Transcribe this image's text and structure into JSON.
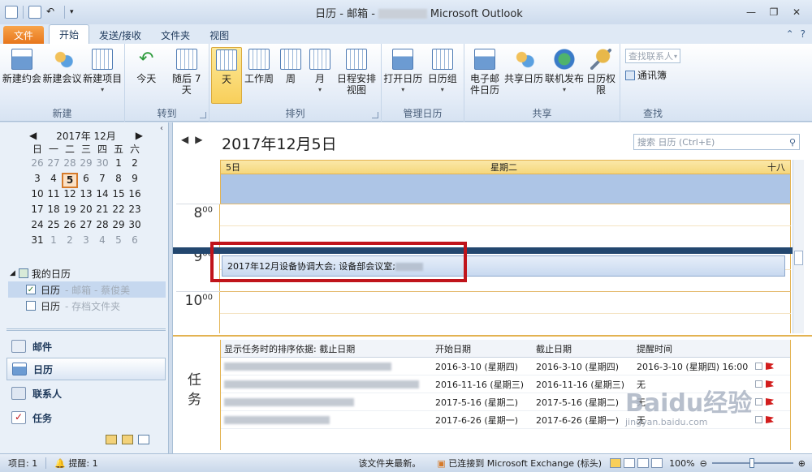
{
  "window": {
    "title_prefix": "日历 - 邮箱 -",
    "title_suffix": "Microsoft Outlook"
  },
  "tabs": {
    "file": "文件",
    "items": [
      "开始",
      "发送/接收",
      "文件夹",
      "视图"
    ]
  },
  "ribbon": {
    "groups": {
      "new": {
        "label": "新建",
        "buttons": [
          "新建约会",
          "新建会议",
          "新建项目"
        ]
      },
      "goto": {
        "label": "转到",
        "buttons": [
          "今天",
          "随后 7 天"
        ]
      },
      "arrange": {
        "label": "排列",
        "buttons": [
          "天",
          "工作周",
          "周",
          "月",
          "日程安排视图"
        ]
      },
      "manage": {
        "label": "管理日历",
        "buttons": [
          "打开日历",
          "日历组"
        ]
      },
      "share": {
        "label": "共享",
        "buttons": [
          "电子邮件日历",
          "共享日历",
          "联机发布",
          "日历权限"
        ]
      },
      "find": {
        "label": "查找",
        "find_contact": "查找联系人",
        "address_book": "通讯簿"
      }
    }
  },
  "minical": {
    "month": "2017年 12月",
    "dow": [
      "日",
      "一",
      "二",
      "三",
      "四",
      "五",
      "六"
    ],
    "rows": [
      [
        "26",
        "27",
        "28",
        "29",
        "30",
        "1",
        "2"
      ],
      [
        "3",
        "4",
        "5",
        "6",
        "7",
        "8",
        "9"
      ],
      [
        "10",
        "11",
        "12",
        "13",
        "14",
        "15",
        "16"
      ],
      [
        "17",
        "18",
        "19",
        "20",
        "21",
        "22",
        "23"
      ],
      [
        "24",
        "25",
        "26",
        "27",
        "28",
        "29",
        "30"
      ],
      [
        "31",
        "1",
        "2",
        "3",
        "4",
        "5",
        "6"
      ]
    ],
    "today": "5"
  },
  "calendars": {
    "group_label": "我的日历",
    "items": [
      {
        "label": "日历",
        "sub": "- 邮箱 - 蔡俊美"
      },
      {
        "label": "日历",
        "sub": "- 存档文件夹"
      }
    ]
  },
  "nav_buttons": [
    "邮件",
    "日历",
    "联系人",
    "任务"
  ],
  "main": {
    "date_title": "2017年12月5日",
    "search_placeholder": "搜索 日历 (Ctrl+E)",
    "day_num": "5日",
    "weekday": "星期二",
    "lunar": "十八",
    "hours": [
      {
        "h": "8",
        "m": "00"
      },
      {
        "h": "9",
        "m": "00"
      },
      {
        "h": "10",
        "m": "00"
      }
    ],
    "event_text": "2017年12月设备协调大会; 设备部会议室;"
  },
  "tasks": {
    "label": "任务",
    "headers": [
      "显示任务时的排序依据: 截止日期",
      "开始日期",
      "截止日期",
      "提醒时间"
    ],
    "rows": [
      {
        "start": "2016-3-10 (星期四)",
        "due": "2016-3-10 (星期四)",
        "reminder": "2016-3-10 (星期四) 16:00"
      },
      {
        "start": "2016-11-16 (星期三)",
        "due": "2016-11-16 (星期三)",
        "reminder": "无"
      },
      {
        "start": "2017-5-16 (星期二)",
        "due": "2017-5-16 (星期二)",
        "reminder": "无"
      },
      {
        "start": "2017-6-26 (星期一)",
        "due": "2017-6-26 (星期一)",
        "reminder": "无"
      }
    ]
  },
  "status": {
    "items": "项目: 1",
    "reminders": "提醒: 1",
    "folder": "该文件夹最新。",
    "connection": "已连接到 Microsoft Exchange (标头)",
    "zoom": "100%"
  },
  "watermark": {
    "main": "Baidu经验",
    "sub": "jingyan.baidu.com"
  }
}
